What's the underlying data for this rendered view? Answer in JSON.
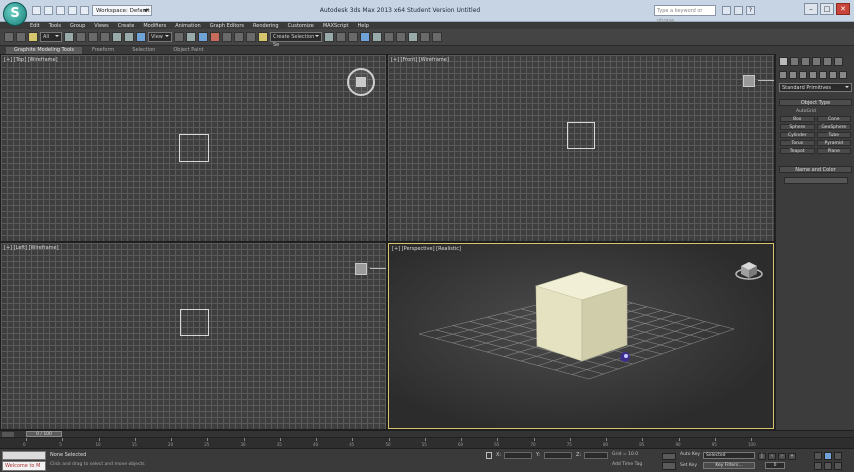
{
  "titlebar": {
    "logo": "S",
    "workspace": "Workspace: Default",
    "title": "Autodesk 3ds Max 2013 x64    Student Version    Untitled",
    "help_search_placeholder": "Type a keyword or phrase",
    "window_controls": [
      "–",
      "□",
      "✕"
    ]
  },
  "menu": [
    "Edit",
    "Tools",
    "Group",
    "Views",
    "Create",
    "Modifiers",
    "Animation",
    "Graph Editors",
    "Rendering",
    "Customize",
    "MAXScript",
    "Help"
  ],
  "toolbar": {
    "selection_filter": "All",
    "ref_coord": "View",
    "named_selection_placeholder": "Create Selection Se"
  },
  "ribbon": {
    "tabs": [
      "Graphite Modeling Tools",
      "Freeform",
      "Selection",
      "Object Paint"
    ]
  },
  "viewports": {
    "top": "[+] [Top] [Wireframe]",
    "front": "[+] [Front] [Wireframe]",
    "left": "[+] [Left] [Wireframe]",
    "perspective": "[+] [Perspective] [Realistic]"
  },
  "command_panel": {
    "category": "Standard Primitives",
    "object_type_title": "Object Type",
    "autogrid": "AutoGrid",
    "objects": [
      "Box",
      "Cone",
      "Sphere",
      "GeoSphere",
      "Cylinder",
      "Tube",
      "Torus",
      "Pyramid",
      "Teapot",
      "Plane"
    ],
    "name_color_title": "Name and Color"
  },
  "timeline": {
    "slider_label": "0 / 100",
    "ticks": [
      "0",
      "5",
      "10",
      "15",
      "20",
      "25",
      "30",
      "35",
      "40",
      "45",
      "50",
      "55",
      "60",
      "65",
      "70",
      "75",
      "80",
      "85",
      "90",
      "95",
      "100"
    ]
  },
  "status": {
    "maxscript_label": "Welcome to M",
    "selection": "None Selected",
    "prompt": "Click and drag to select and move objects",
    "x_label": "X:",
    "y_label": "Y:",
    "z_label": "Z:",
    "grid": "Grid = 10.0",
    "add_time_tag": "Add Time Tag",
    "auto_key": "Auto Key",
    "selected": "Selected",
    "set_key": "Set Key",
    "key_filters": "Key Filters...",
    "frame": "0"
  },
  "colors": {
    "viewport_bg": "#3e3e3e",
    "grid_line": "#5a5a5a",
    "active_border": "#d7c56e",
    "box": "#e7e5c4",
    "titlebar": "#c7d4e3"
  }
}
